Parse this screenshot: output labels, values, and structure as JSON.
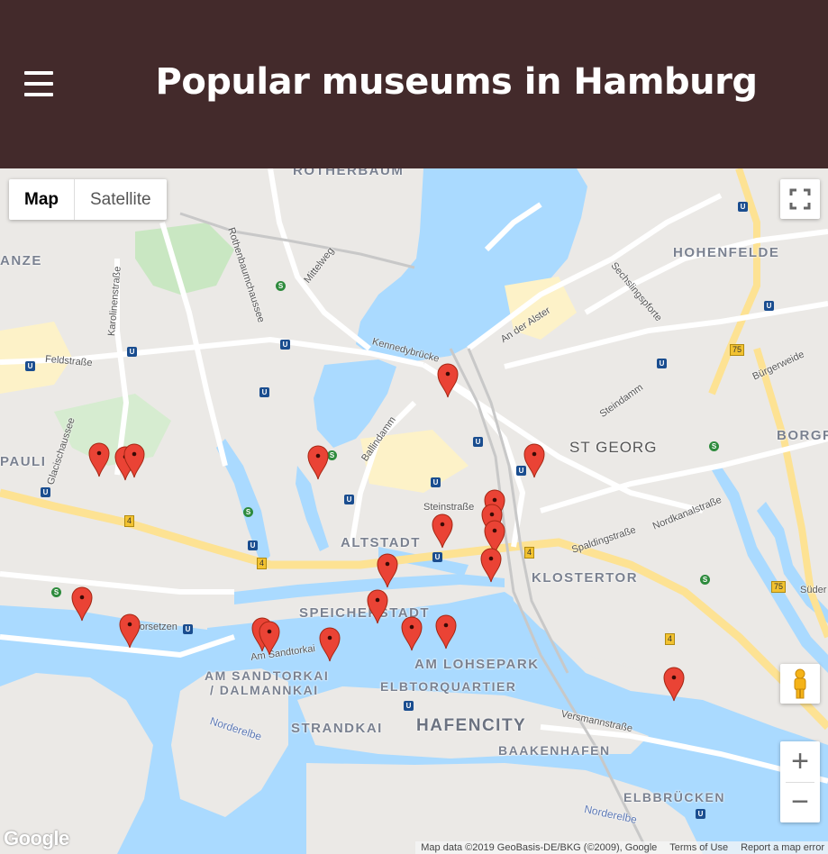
{
  "header": {
    "title": "Popular museums in Hamburg",
    "menu_label": "Menu"
  },
  "map_controls": {
    "map_label": "Map",
    "satellite_label": "Satellite",
    "zoom_in": "+",
    "zoom_out": "−"
  },
  "districts": [
    {
      "name": "ROTHERBAUM"
    },
    {
      "name": "HOHENFELDE"
    },
    {
      "name": "ANZE"
    },
    {
      "name": "ST GEORG"
    },
    {
      "name": "BORGF"
    },
    {
      "name": "PAULI"
    },
    {
      "name": "ALTSTADT"
    },
    {
      "name": "KLOSTERTOR"
    },
    {
      "name": "SPEICHERSTADT"
    },
    {
      "name": "AM LOHSEPARK"
    },
    {
      "name": "AM SANDTORKAI"
    },
    {
      "name": "/ DALMANNKAI"
    },
    {
      "name": "ELBTORQUARTIER"
    },
    {
      "name": "STRANDKAI"
    },
    {
      "name": "HAFENCITY"
    },
    {
      "name": "BAAKENHAFEN"
    },
    {
      "name": "ELBBRÜCKEN"
    }
  ],
  "streets": [
    {
      "name": "Rothenbaumchaussee"
    },
    {
      "name": "Mittelweg"
    },
    {
      "name": "Karolinenstraße"
    },
    {
      "name": "Feldstraße"
    },
    {
      "name": "Glacischaussee"
    },
    {
      "name": "Kennedybrücke"
    },
    {
      "name": "An der Alster"
    },
    {
      "name": "Sechslingspforte"
    },
    {
      "name": "Bürgerweide"
    },
    {
      "name": "Steindamm"
    },
    {
      "name": "Ballindamm"
    },
    {
      "name": "Steinstraße"
    },
    {
      "name": "Spaldingstraße"
    },
    {
      "name": "Nordkanalstraße"
    },
    {
      "name": "Am Sandtorkai"
    },
    {
      "name": "Vorsetzen"
    },
    {
      "name": "Versmannstraße"
    },
    {
      "name": "Norderelbe"
    },
    {
      "name": "Norderelbe"
    },
    {
      "name": "Süder"
    }
  ],
  "road_numbers": [
    "4",
    "4",
    "4",
    "4",
    "75",
    "75"
  ],
  "footer": {
    "map_data": "Map data ©2019 GeoBasis-DE/BKG (©2009), Google",
    "terms": "Terms of Use",
    "report": "Report a map error"
  },
  "logo": "Google"
}
